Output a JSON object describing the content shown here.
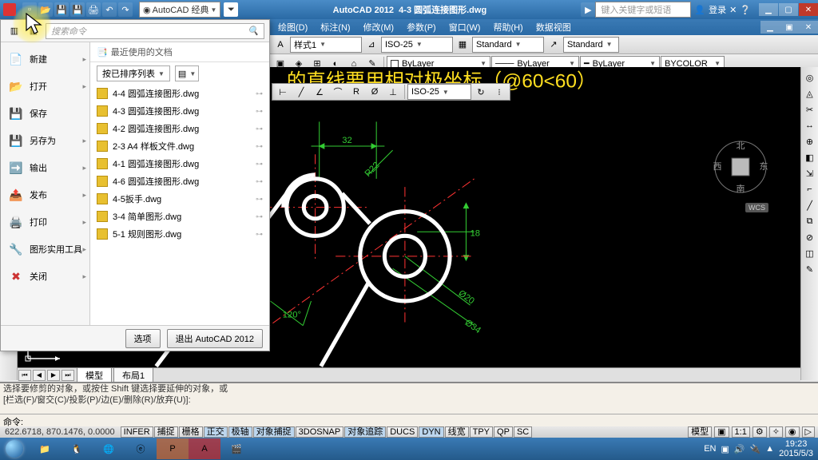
{
  "title": {
    "app": "AutoCAD 2012",
    "doc": "4-3 圆弧连接图形.dwg"
  },
  "workspace": "AutoCAD 经典",
  "title_search_ph": "键入关键字或短语",
  "login": "登录",
  "menus": [
    "绘图(D)",
    "标注(N)",
    "修改(M)",
    "参数(P)",
    "窗口(W)",
    "帮助(H)",
    "数据视图"
  ],
  "style_combo_a": "样式1",
  "style_combo_b": "ISO-25",
  "style_combo_c": "Standard",
  "style_combo_d": "Standard",
  "layer": {
    "bylayer1": "ByLayer",
    "bylayer2": "ByLayer",
    "bylayer3": "ByLayer",
    "bycolor": "BYCOLOR"
  },
  "dimstyle_combo": "ISO-25",
  "app_menu": {
    "search_ph": "搜索命令",
    "left": [
      {
        "icon": "📄",
        "label": "新建"
      },
      {
        "icon": "📂",
        "label": "打开"
      },
      {
        "icon": "💾",
        "label": "保存"
      },
      {
        "icon": "💾",
        "label": "另存为"
      },
      {
        "icon": "➡️",
        "label": "输出"
      },
      {
        "icon": "📤",
        "label": "发布"
      },
      {
        "icon": "🖨️",
        "label": "打印"
      },
      {
        "icon": "🔧",
        "label": "图形实用工具"
      },
      {
        "icon": "✖",
        "label": "关闭"
      }
    ],
    "recent_title": "最近使用的文档",
    "sort_label": "按已排序列表",
    "recent": [
      "4-4 圆弧连接图形.dwg",
      "4-3 圆弧连接图形.dwg",
      "4-2 圆弧连接图形.dwg",
      "2-3 A4 样板文件.dwg",
      "4-1 圆弧连接图形.dwg",
      "4-6 圆弧连接图形.dwg",
      "4-5扳手.dwg",
      "3-4 简单图形.dwg",
      "5-1 规则图形.dwg"
    ],
    "footer": {
      "options": "选项",
      "exit": "退出 AutoCAD 2012"
    }
  },
  "canvas_text": "的直线要用相对极坐标（@60<60）",
  "layout_tabs": {
    "model": "模型",
    "layout1": "布局1"
  },
  "cmd": {
    "line1": "选择要修剪的对象，或按住 Shift 键选择要延伸的对象，或",
    "line2": "[栏选(F)/窗交(C)/投影(P)/边(E)/删除(R)/放弃(U)]:",
    "prompt": "命令:"
  },
  "coords": "622.6718, 870.1476, 0.0000",
  "status_btns": [
    "INFER",
    "捕捉",
    "栅格",
    "正交",
    "极轴",
    "对象捕捉",
    "3DOSNAP",
    "对象追踪",
    "DUCS",
    "DYN",
    "线宽",
    "TPY",
    "QP",
    "SC"
  ],
  "status_right": {
    "model": "模型",
    "scale": "1:1"
  },
  "viewcube": {
    "n": "北",
    "s": "南",
    "e": "东",
    "w": "西",
    "wcs": "WCS"
  },
  "dims": {
    "d32": "32",
    "r22": "R22",
    "d18": "18",
    "d120": "120°",
    "phi20": "Ø20",
    "phi34": "Ø34"
  },
  "tray": {
    "lang": "EN",
    "time": "19:23",
    "date": "2015/5/3"
  }
}
